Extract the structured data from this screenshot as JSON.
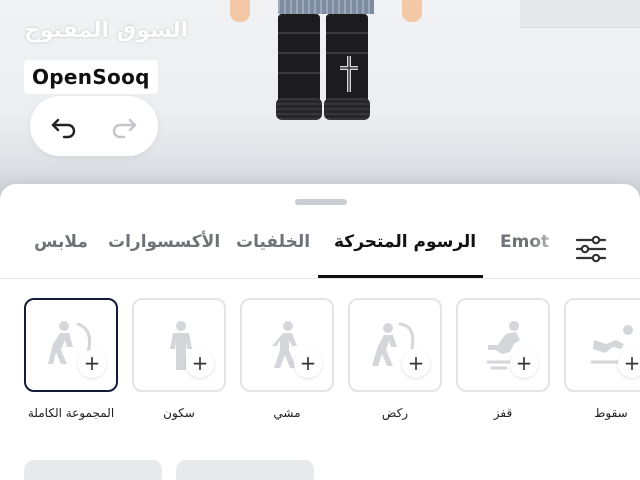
{
  "watermark": {
    "arabic": "السوق المفتوح",
    "brand": "OpenSooq"
  },
  "history": {
    "undo_icon": "undo-arrow-icon",
    "redo_icon": "redo-arrow-icon"
  },
  "tabs": {
    "items": [
      {
        "label": "ملابس"
      },
      {
        "label": "الأكسسوارات"
      },
      {
        "label": "الخلفيات"
      },
      {
        "label": "الرسوم المتحركة",
        "active": true
      },
      {
        "label": "Emot"
      }
    ],
    "filter_icon": "sliders-icon"
  },
  "animations": [
    {
      "label": "المجموعة الكاملة",
      "icon": "full-pack-figure-icon",
      "selected": true
    },
    {
      "label": "سكون",
      "icon": "idle-figure-icon"
    },
    {
      "label": "مشي",
      "icon": "walk-figure-icon"
    },
    {
      "label": "ركض",
      "icon": "run-figure-icon"
    },
    {
      "label": "قفز",
      "icon": "jump-figure-icon"
    },
    {
      "label": "سقوط",
      "icon": "fall-figure-icon"
    }
  ],
  "colors": {
    "selected_border": "#161b3a",
    "active_tab": "#111111",
    "inactive_tab": "#6f7378"
  }
}
